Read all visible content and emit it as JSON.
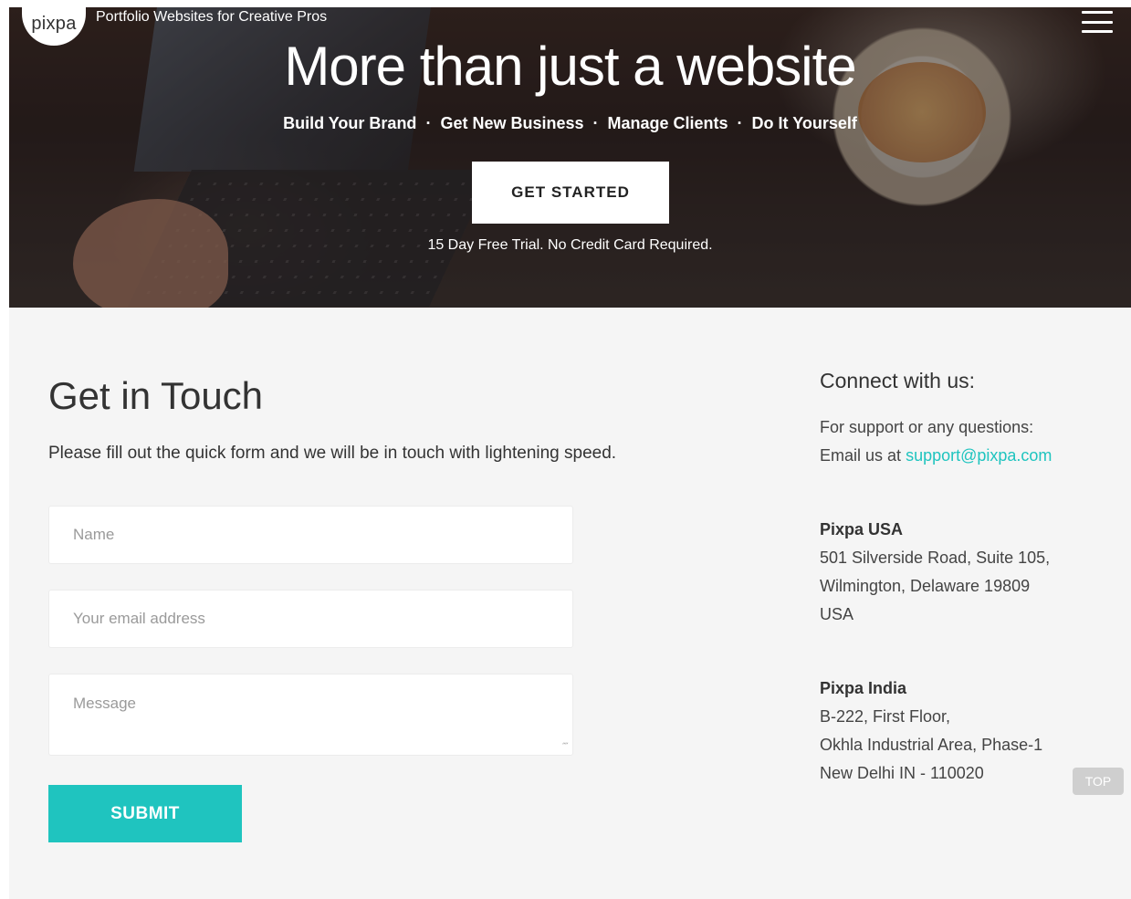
{
  "header": {
    "logo_text": "pixpa",
    "tagline": "Portfolio Websites for Creative Pros",
    "menu_icon": "hamburger-menu-icon"
  },
  "hero": {
    "title": "More than just a website",
    "features": [
      "Build Your Brand",
      "Get New Business",
      "Manage Clients",
      "Do It Yourself"
    ],
    "separator": "·",
    "cta_label": "GET STARTED",
    "trial_note": "15 Day Free Trial. No Credit Card Required."
  },
  "contact_form": {
    "title": "Get in Touch",
    "subtitle": "Please fill out the quick form and we will be in touch with lightening speed.",
    "name_placeholder": "Name",
    "email_placeholder": "Your email address",
    "message_placeholder": "Message",
    "submit_label": "SUBMIT"
  },
  "connect": {
    "title": "Connect with us:",
    "support_line": "For support or any questions:",
    "email_prefix": "Email us at",
    "email": "support@pixpa.com",
    "offices": [
      {
        "name": "Pixpa USA",
        "lines": [
          "501 Silverside Road, Suite 105,",
          "Wilmington, Delaware 19809",
          "USA"
        ]
      },
      {
        "name": "Pixpa India",
        "lines": [
          "B-222, First Floor,",
          "Okhla Industrial Area, Phase-1",
          "New Delhi IN - 110020"
        ]
      }
    ]
  },
  "top_button_label": "TOP",
  "colors": {
    "accent": "#1fc4bf",
    "background": "#f5f5f5"
  }
}
